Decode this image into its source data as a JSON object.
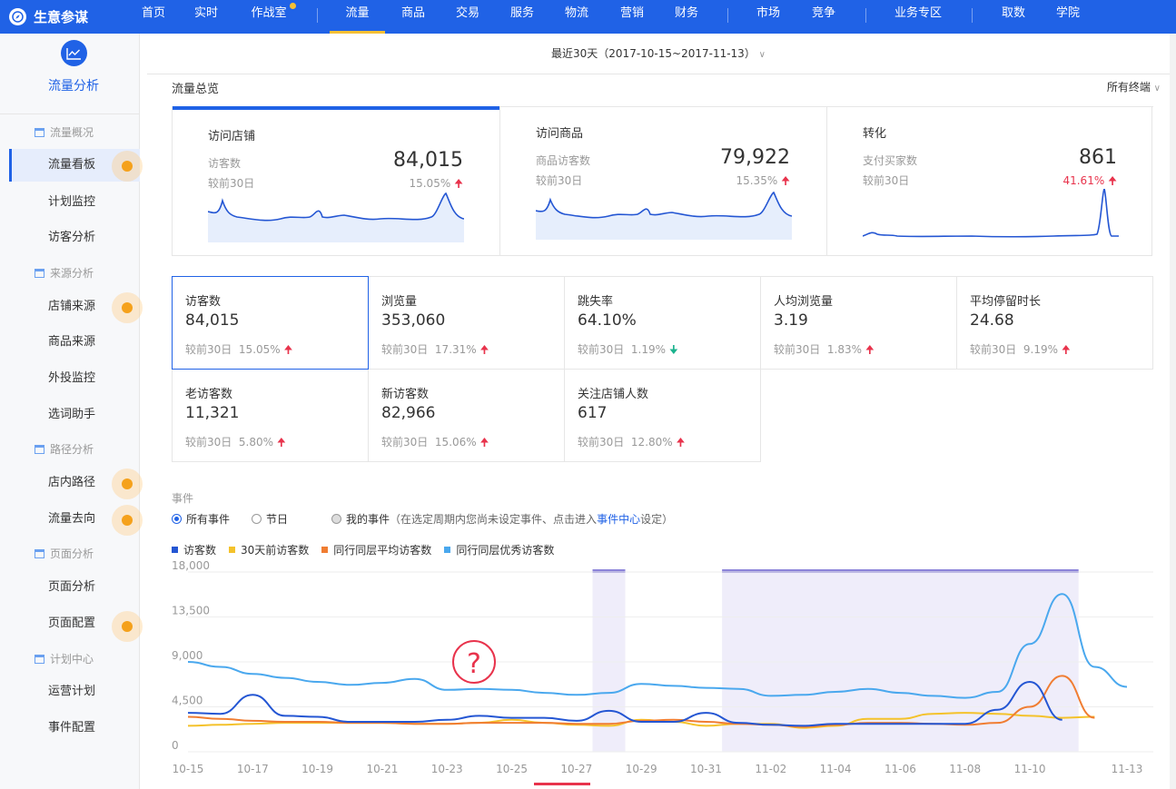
{
  "app": {
    "name": "生意参谋"
  },
  "nav": {
    "items": [
      "首页",
      "实时",
      "作战室",
      "流量",
      "商品",
      "交易",
      "服务",
      "物流",
      "营销",
      "财务",
      "市场",
      "竞争",
      "业务专区",
      "取数",
      "学院"
    ],
    "active": "流量"
  },
  "sidebar": {
    "title": "流量分析",
    "groups": {
      "overview": "流量概况",
      "source": "来源分析",
      "path": "路径分析",
      "page": "页面分析",
      "plan": "计划中心"
    },
    "items": {
      "board": "流量看板",
      "plan_monitor": "计划监控",
      "visitor_analysis": "访客分析",
      "shop_source": "店铺来源",
      "product_source": "商品来源",
      "external": "外投监控",
      "keyword": "选词助手",
      "shop_path": "店内路径",
      "flow_dest": "流量去向",
      "page_analysis": "页面分析",
      "page_config": "页面配置",
      "ops_plan": "运营计划",
      "event_config": "事件配置"
    }
  },
  "date_range": "最近30天（2017-10-15~2017-11-13）",
  "overview": {
    "title": "流量总览",
    "terminals": "所有终端",
    "cards": [
      {
        "title": "访问店铺",
        "label": "访客数",
        "value": "84,015",
        "cmp": "较前30日",
        "pct": "15.05%"
      },
      {
        "title": "访问商品",
        "label": "商品访客数",
        "value": "79,922",
        "cmp": "较前30日",
        "pct": "15.35%"
      },
      {
        "title": "转化",
        "label": "支付买家数",
        "value": "861",
        "cmp": "较前30日",
        "pct": "41.61%"
      }
    ]
  },
  "metrics": [
    {
      "name": "访客数",
      "value": "84,015",
      "cmp": "较前30日",
      "pct": "15.05%",
      "dir": "up"
    },
    {
      "name": "浏览量",
      "value": "353,060",
      "cmp": "较前30日",
      "pct": "17.31%",
      "dir": "up"
    },
    {
      "name": "跳失率",
      "value": "64.10%",
      "cmp": "较前30日",
      "pct": "1.19%",
      "dir": "down"
    },
    {
      "name": "人均浏览量",
      "value": "3.19",
      "cmp": "较前30日",
      "pct": "1.83%",
      "dir": "up"
    },
    {
      "name": "平均停留时长",
      "value": "24.68",
      "cmp": "较前30日",
      "pct": "9.19%",
      "dir": "up"
    },
    {
      "name": "老访客数",
      "value": "11,321",
      "cmp": "较前30日",
      "pct": "5.80%",
      "dir": "up"
    },
    {
      "name": "新访客数",
      "value": "82,966",
      "cmp": "较前30日",
      "pct": "15.06%",
      "dir": "up"
    },
    {
      "name": "关注店铺人数",
      "value": "617",
      "cmp": "较前30日",
      "pct": "12.80%",
      "dir": "up"
    }
  ],
  "events": {
    "title": "事件",
    "options": [
      "所有事件",
      "节日",
      "我的事件"
    ],
    "selected": "所有事件",
    "hint_prefix": "（在选定周期内您尚未设定事件、点击进入",
    "hint_link": "事件中心",
    "hint_suffix": "设定）"
  },
  "colors": {
    "brand": "#2062e6",
    "visitors": "#2456d3",
    "last30": "#f4c22b",
    "peer_avg": "#f07d32",
    "peer_top": "#4aa8ee",
    "up": "#e8334c",
    "down": "#1bb38e"
  },
  "chart_data": {
    "type": "line",
    "x": [
      "10-15",
      "10-16",
      "10-17",
      "10-18",
      "10-19",
      "10-20",
      "10-21",
      "10-22",
      "10-23",
      "10-24",
      "10-25",
      "10-26",
      "10-27",
      "10-28",
      "10-29",
      "10-30",
      "10-31",
      "11-01",
      "11-02",
      "11-03",
      "11-04",
      "11-05",
      "11-06",
      "11-07",
      "11-08",
      "11-09",
      "11-10",
      "11-11",
      "11-12",
      "11-13"
    ],
    "x_tick_labels": [
      "10-15",
      "10-17",
      "10-19",
      "10-21",
      "10-23",
      "10-25",
      "10-27",
      "10-29",
      "10-31",
      "11-02",
      "11-04",
      "11-06",
      "11-08",
      "11-10",
      "11-13"
    ],
    "ylim": [
      0,
      18000
    ],
    "y_ticks": [
      0,
      4500,
      9000,
      13500,
      18000
    ],
    "y_tick_labels": [
      "0",
      "4,500",
      "9,000",
      "13,500",
      "18,000"
    ],
    "grid": true,
    "legend_position": "top-left",
    "event_bands": [
      [
        "10-28",
        "10-28"
      ],
      [
        "11-01",
        "11-11"
      ]
    ],
    "series": [
      {
        "name": "访客数",
        "values": [
          3900,
          3800,
          5700,
          3600,
          3500,
          3000,
          3000,
          3000,
          3200,
          3600,
          3400,
          3400,
          3100,
          4100,
          3000,
          3000,
          3900,
          2900,
          2700,
          2600,
          2800,
          2800,
          2800,
          2800,
          2800,
          4200,
          7000,
          3200,
          null,
          null
        ]
      },
      {
        "name": "30天前访客数",
        "values": [
          2600,
          2700,
          2800,
          2900,
          2900,
          2900,
          2900,
          2800,
          2800,
          2900,
          3200,
          2900,
          2700,
          2600,
          3200,
          3000,
          2600,
          2800,
          2800,
          2400,
          2600,
          3300,
          3300,
          3800,
          3900,
          3800,
          3600,
          3400,
          3500,
          null
        ]
      },
      {
        "name": "同行同层平均访客数",
        "values": [
          3500,
          3300,
          3100,
          3000,
          3000,
          2900,
          2900,
          2800,
          2800,
          2900,
          2900,
          2900,
          2800,
          2800,
          3100,
          3200,
          3000,
          2800,
          2700,
          2500,
          2700,
          2900,
          2900,
          2800,
          2700,
          2900,
          4500,
          7600,
          3400,
          null
        ]
      },
      {
        "name": "同行同层优秀访客数",
        "values": [
          9000,
          8500,
          7800,
          7400,
          7000,
          6700,
          6900,
          7300,
          6200,
          6300,
          6200,
          5900,
          5700,
          5900,
          6800,
          6600,
          6400,
          6300,
          5600,
          5700,
          6000,
          6300,
          5900,
          5600,
          5400,
          6000,
          10800,
          15800,
          8500,
          6500
        ]
      }
    ]
  }
}
